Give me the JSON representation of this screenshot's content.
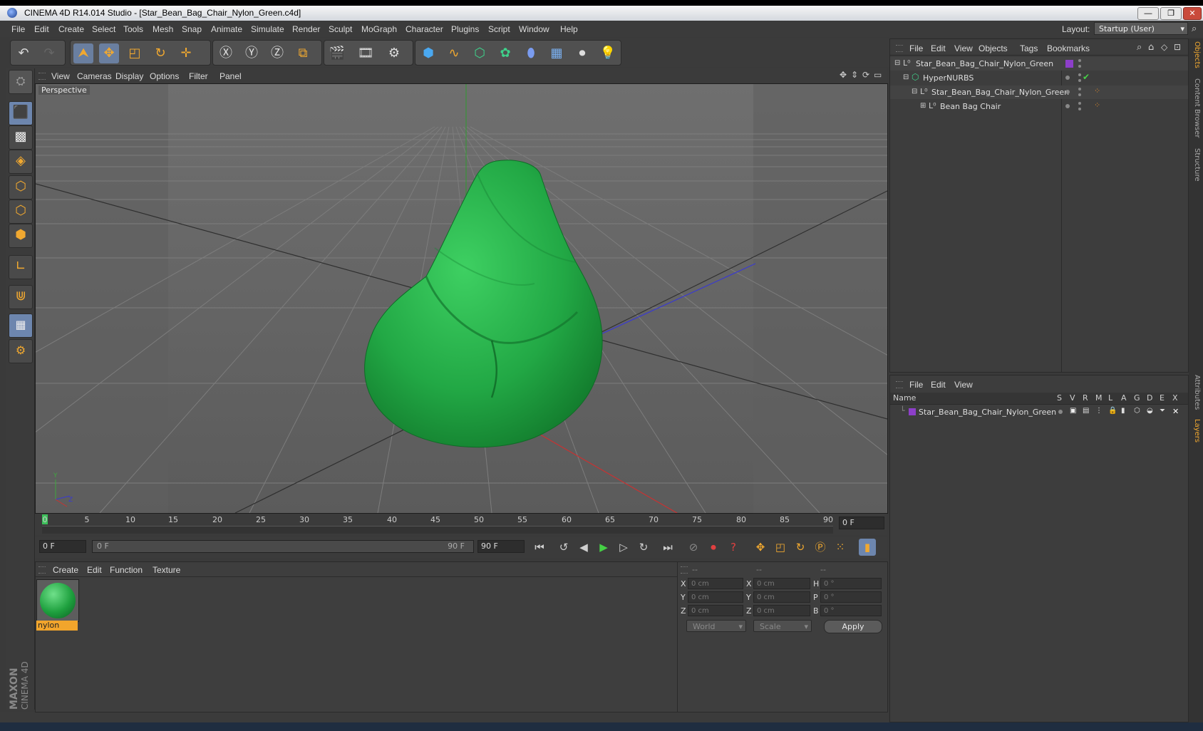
{
  "window": {
    "title": "CINEMA 4D R14.014 Studio - [Star_Bean_Bag_Chair_Nylon_Green.c4d]",
    "minimize": "—",
    "maximize": "❐",
    "close": "✕"
  },
  "menubar": {
    "items": [
      "File",
      "Edit",
      "Create",
      "Select",
      "Tools",
      "Mesh",
      "Snap",
      "Animate",
      "Simulate",
      "Render",
      "Sculpt",
      "MoGraph",
      "Character",
      "Plugins",
      "Script",
      "Window",
      "Help"
    ],
    "layout_label": "Layout:",
    "layout_value": "Startup (User)"
  },
  "viewport": {
    "menu": [
      "View",
      "Cameras",
      "Display",
      "Options",
      "Filter",
      "Panel"
    ],
    "label": "Perspective"
  },
  "timeline": {
    "ticks": [
      "0",
      "5",
      "10",
      "15",
      "20",
      "25",
      "30",
      "35",
      "40",
      "45",
      "50",
      "55",
      "60",
      "65",
      "70",
      "75",
      "80",
      "85",
      "90"
    ],
    "current_frame": "0 F",
    "start_frame": "0 F",
    "range_start": "0 F",
    "range_end": "90 F",
    "end_frame": "90 F"
  },
  "material_manager": {
    "menu": [
      "Create",
      "Edit",
      "Function",
      "Texture"
    ],
    "materials": [
      {
        "name": "nylon"
      }
    ]
  },
  "coordinates": {
    "header": [
      "--",
      "--",
      "--"
    ],
    "rows": [
      {
        "a": "X",
        "av": "0 cm",
        "b": "X",
        "bv": "0 cm",
        "c": "H",
        "cv": "0 °"
      },
      {
        "a": "Y",
        "av": "0 cm",
        "b": "Y",
        "bv": "0 cm",
        "c": "P",
        "cv": "0 °"
      },
      {
        "a": "Z",
        "av": "0 cm",
        "b": "Z",
        "bv": "0 cm",
        "c": "B",
        "cv": "0 °"
      }
    ],
    "mode_1": "World",
    "mode_2": "Scale",
    "apply": "Apply"
  },
  "object_manager": {
    "menu": [
      "File",
      "Edit",
      "View",
      "Objects",
      "Tags",
      "Bookmarks"
    ],
    "objects": [
      {
        "name": "Star_Bean_Bag_Chair_Nylon_Green"
      },
      {
        "name": "HyperNURBS"
      },
      {
        "name": "Star_Bean_Bag_Chair_Nylon_Green"
      },
      {
        "name": "Bean Bag Chair"
      }
    ]
  },
  "layer_manager": {
    "menu": [
      "File",
      "Edit",
      "View"
    ],
    "columns": [
      "Name",
      "S",
      "V",
      "R",
      "M",
      "L",
      "A",
      "G",
      "D",
      "E",
      "X"
    ],
    "layers": [
      {
        "name": "Star_Bean_Bag_Chair_Nylon_Green"
      }
    ]
  },
  "right_tabs": [
    "Objects",
    "Content Browser",
    "Structure",
    "Attributes",
    "Layers"
  ],
  "branding": {
    "line1": "MAXON",
    "line2": "CINEMA 4D"
  },
  "colors": {
    "accent": "#f2a52c",
    "selected_tool": "#6d86ae",
    "chair_green": "#22a845",
    "layer_color": "#8d3fc9"
  }
}
